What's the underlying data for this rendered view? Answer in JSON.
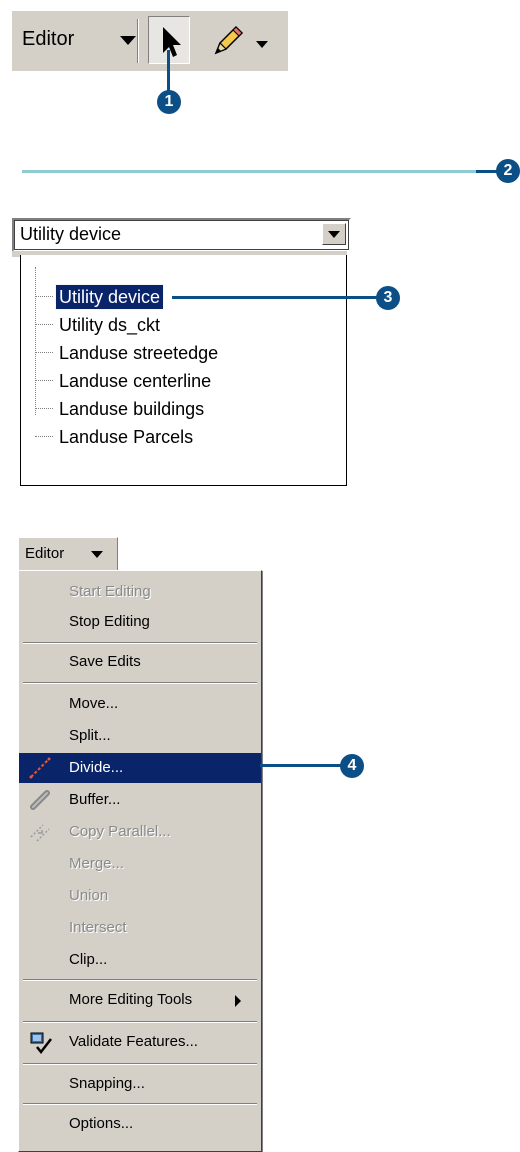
{
  "toolbar": {
    "editor_label": "Editor"
  },
  "callouts": {
    "c1": "1",
    "c2": "2",
    "c3": "3",
    "c4": "4"
  },
  "layer_combo": {
    "selected": "Utility device",
    "items": [
      "Utility device",
      "Utility ds_ckt",
      "Landuse streetedge",
      "Landuse centerline",
      "Landuse buildings",
      "Landuse Parcels"
    ]
  },
  "editor_menu": {
    "header": "Editor",
    "items": {
      "start_editing": "Start Editing",
      "stop_editing": "Stop Editing",
      "save_edits": "Save Edits",
      "move": "Move...",
      "split": "Split...",
      "divide": "Divide...",
      "buffer": "Buffer...",
      "copy_parallel": "Copy Parallel...",
      "merge": "Merge...",
      "union": "Union",
      "intersect": "Intersect",
      "clip": "Clip...",
      "more_tools": "More Editing Tools",
      "validate": "Validate Features...",
      "snapping": "Snapping...",
      "options": "Options..."
    }
  },
  "colors": {
    "callout": "#0b4f86",
    "highlight": "#0a246a",
    "menu_bg": "#d4d0c8",
    "teal_line": "#8fcbd3"
  }
}
